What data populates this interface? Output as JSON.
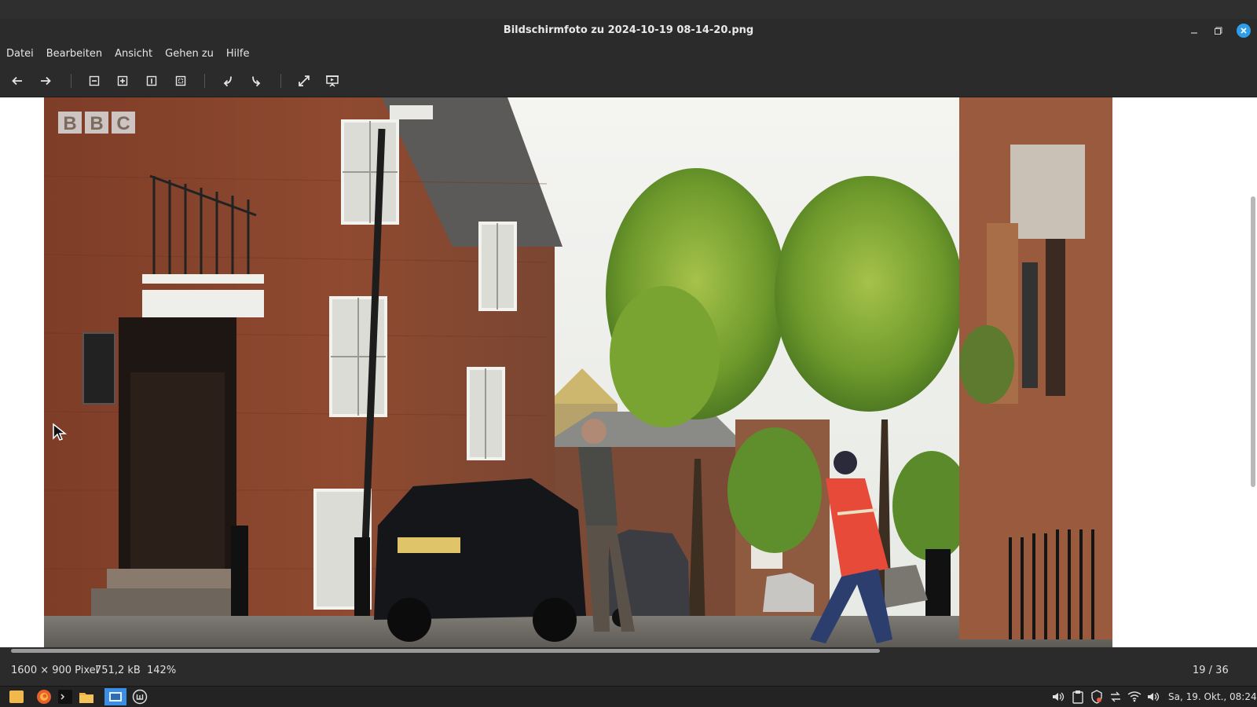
{
  "window": {
    "title": "Bildschirmfoto zu 2024-10-19 08-14-20.png",
    "accent_color": "#2f9ee8"
  },
  "menu": {
    "items": [
      "Datei",
      "Bearbeiten",
      "Ansicht",
      "Gehen zu",
      "Hilfe"
    ]
  },
  "toolbar": {
    "icons": [
      "arrow-left-icon",
      "arrow-right-icon",
      "zoom-out-icon",
      "zoom-in-icon",
      "zoom-original-icon",
      "zoom-fit-icon",
      "rotate-left-icon",
      "rotate-right-icon",
      "fullscreen-icon",
      "slideshow-icon"
    ]
  },
  "image": {
    "logo_text": "BBC"
  },
  "status": {
    "dimensions": "1600 × 900 Pixel",
    "filesize": "751,2 kB",
    "zoom": "142%",
    "position": "19 / 36"
  },
  "taskbar": {
    "clock": "Sa, 19. Okt., 08:24"
  }
}
